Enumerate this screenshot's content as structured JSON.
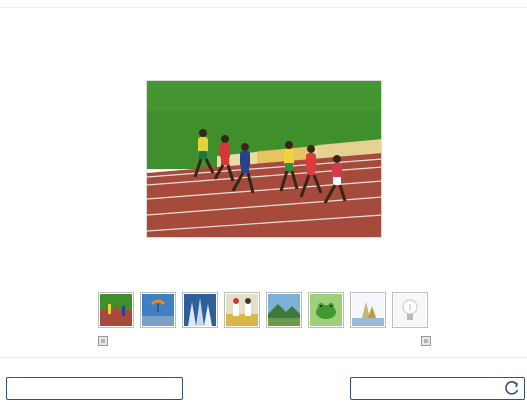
{
  "gallery": {
    "main_image": "sprinters-race-photo",
    "thumbnails": [
      {
        "name": "thumb-sprinters",
        "icon": "race-track-photo"
      },
      {
        "name": "thumb-paraglider",
        "icon": "sky-paraglider-photo"
      },
      {
        "name": "thumb-ice",
        "icon": "ice-formation-photo"
      },
      {
        "name": "thumb-fencing",
        "icon": "fencing-photo"
      },
      {
        "name": "thumb-landscape",
        "icon": "mountain-landscape-photo"
      },
      {
        "name": "thumb-frog",
        "icon": "green-frog-photo"
      },
      {
        "name": "thumb-sculpture",
        "icon": "sculpture-photo"
      },
      {
        "name": "thumb-lightbulb",
        "icon": "lightbulb-photo"
      }
    ],
    "prev_icon": "prev-arrow-icon",
    "next_icon": "next-arrow-icon"
  },
  "footer": {
    "left_input_value": "",
    "right_input_value": "",
    "refresh_icon": "refresh-icon"
  },
  "colors": {
    "field_border": "#33507a",
    "thumb_border": "#bfbfbf",
    "track": "#a64a3c",
    "grass": "#3f8f2d"
  }
}
